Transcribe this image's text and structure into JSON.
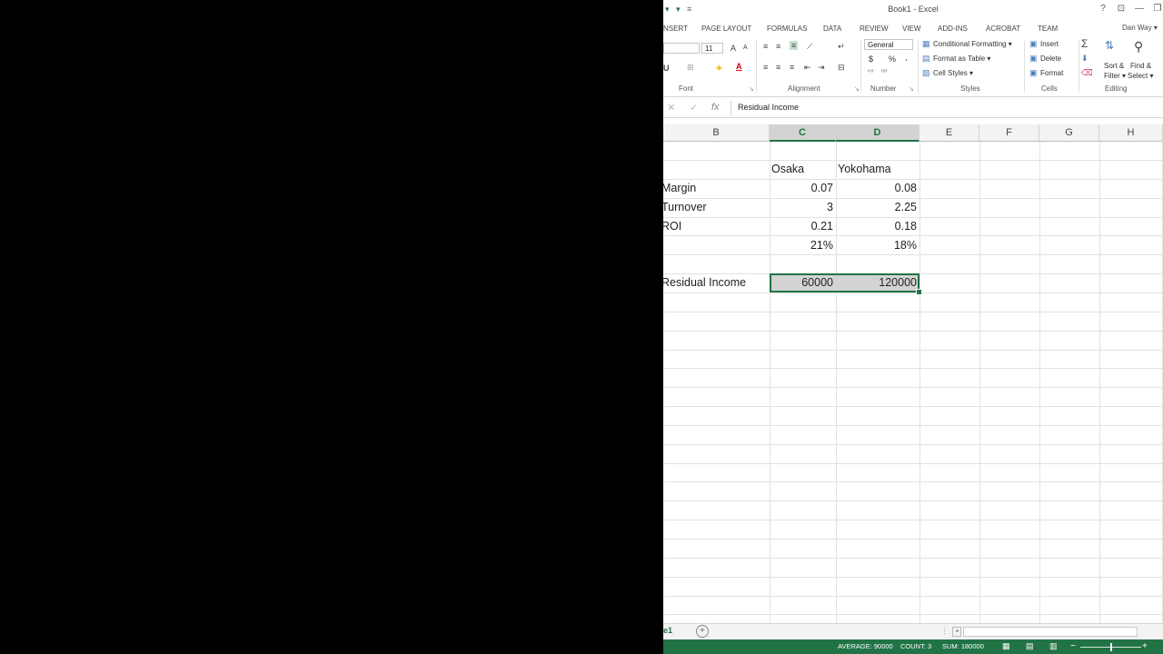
{
  "window": {
    "title": "Book1 - Excel",
    "help": "?",
    "ribbon_display": "⊡",
    "minimize": "—",
    "restore": "❐",
    "user": "Dan Way ▾"
  },
  "tabs": [
    "NSERT",
    "PAGE LAYOUT",
    "FORMULAS",
    "DATA",
    "REVIEW",
    "VIEW",
    "ADD-INS",
    "ACROBAT",
    "TEAM"
  ],
  "ribbon": {
    "font_size": "11",
    "number_format": "General",
    "currency": "$",
    "percent": "%",
    "comma": ",",
    "dec_inc": "⁺⁰",
    "dec_dec": "⁰⁰",
    "conditional_formatting": "Conditional Formatting ▾",
    "format_as_table": "Format as Table ▾",
    "cell_styles": "Cell Styles ▾",
    "insert": "Insert",
    "delete": "Delete",
    "format": "Format",
    "sort_filter_1": "Sort &",
    "sort_filter_2": "Filter ▾",
    "find_select_1": "Find &",
    "find_select_2": "Select ▾",
    "groups": {
      "font": "Font",
      "alignment": "Alignment",
      "number": "Number",
      "styles": "Styles",
      "cells": "Cells",
      "editing": "Editing"
    }
  },
  "formula_bar": {
    "cancel": "✕",
    "enter": "✓",
    "fx": "fx",
    "value": "Residual Income"
  },
  "columns": [
    "B",
    "C",
    "D",
    "E",
    "F",
    "G",
    "H"
  ],
  "cells": {
    "c_header": "Osaka",
    "d_header": "Yokohama",
    "row_margin": {
      "label": "Margin",
      "c": "0.07",
      "d": "0.08"
    },
    "row_turnover": {
      "label": "Turnover",
      "c": "3",
      "d": "2.25"
    },
    "row_roi": {
      "label": "ROI",
      "c": "0.21",
      "d": "0.18"
    },
    "row_pct": {
      "c": "21%",
      "d": "18%"
    },
    "row_residual": {
      "label": "Residual Income",
      "c": "60000",
      "d": "120000"
    }
  },
  "sheet": {
    "tab_fragment": "e1",
    "add": "+"
  },
  "status": {
    "average": "AVERAGE: 90000",
    "count": "COUNT: 3",
    "sum": "SUM: 180000",
    "zoom_minus": "−",
    "zoom_plus": "+"
  }
}
